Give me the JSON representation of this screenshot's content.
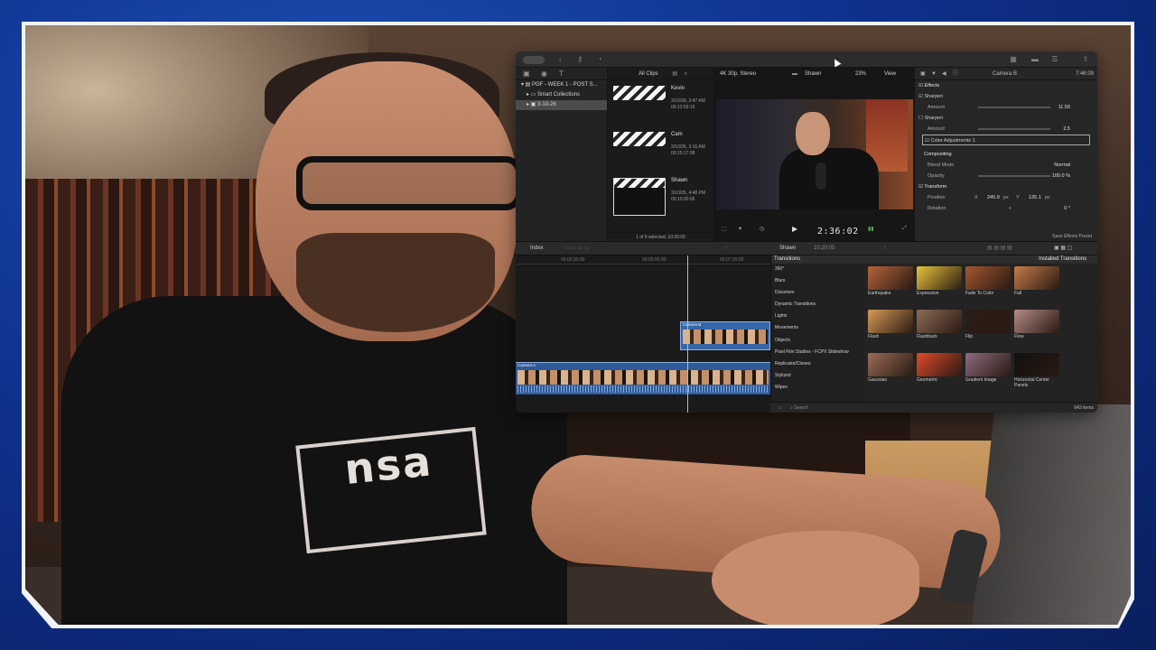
{
  "fcp": {
    "sidebar": {
      "items": [
        "PGF - WEEK 1 - POST S...",
        "Smart Collections",
        "3-10-26"
      ]
    },
    "browser": {
      "filter": "All Clips",
      "clips": [
        {
          "name": "Kevin",
          "meta1": "3/10/26, 2:47 AM",
          "meta2": "00:12:59:15"
        },
        {
          "name": "Cam",
          "meta1": "3/10/26, 3:16 AM",
          "meta2": "00:15:17:08"
        },
        {
          "name": "Shawn",
          "meta1": "3/10/26, 4:48 PM",
          "meta2": "00:10:20:05"
        }
      ],
      "status": "1 of 5 selected, 10:20:05"
    },
    "viewer": {
      "format": "4K 30p, Stereo",
      "clip": "Shawn",
      "zoom": "23%",
      "view": "View",
      "timecode": "2:36:02"
    },
    "inspector": {
      "title": "Camera B",
      "duration": "7:46:09",
      "effects": "Effects",
      "sharpen1": "Sharpen",
      "amount_label": "Amount",
      "amount1": "11.59",
      "sharpen2": "Sharpen",
      "amount2": "2.5",
      "color_adj": "Color Adjustments 1",
      "compositing": "Compositing",
      "blend_mode": "Blend Mode",
      "blend_value": "Normal",
      "opacity": "Opacity",
      "opacity_value": "100.0 %",
      "transform": "Transform",
      "position": "Position",
      "pos_x_label": "X",
      "pos_x": "245.9",
      "pos_y_label": "Y",
      "pos_y": "135.1",
      "unit": "px",
      "rotation": "Rotation",
      "rotation_value": "0 °",
      "save_preset": "Save Effects Preset"
    },
    "timeline": {
      "index": "Index",
      "clip": "Shawn",
      "duration": "10:20:05",
      "ruler": [
        "00:02:30:00",
        "00:05:00:00",
        "00:07:30:00"
      ],
      "clip_b": "Camera B",
      "clip_a": "Camera A"
    },
    "transitions": {
      "header": "Transitions",
      "installed": "Installed Transitions",
      "categories": [
        "360°",
        "Blurs",
        "Dissolves",
        "Dynamic Transitions",
        "Lights",
        "Movements",
        "Objects",
        "Pixel Film Studios - FCPX Slideshow",
        "Replicator/Clones",
        "Stylized",
        "Wipes"
      ],
      "items": [
        {
          "label": "Earthquake",
          "color": "#b7653a"
        },
        {
          "label": "Expressive",
          "color": "#e8c43a"
        },
        {
          "label": "Fade To Color",
          "color": "#a45631"
        },
        {
          "label": "Fall",
          "color": "#c57a48"
        },
        {
          "label": "Flash",
          "color": "#d79b55"
        },
        {
          "label": "Flashback",
          "color": "#8c6a55"
        },
        {
          "label": "Flip",
          "color": "#2a1c17"
        },
        {
          "label": "Flow",
          "color": "#b58a88"
        },
        {
          "label": "Gaussian",
          "color": "#9b6d56"
        },
        {
          "label": "Geometric",
          "color": "#e04a2a"
        },
        {
          "label": "Gradient Image",
          "color": "#8e6b80"
        },
        {
          "label": "Horizontal Center Panels",
          "color": "#101010"
        }
      ],
      "search_placeholder": "Search",
      "count": "643 items"
    }
  },
  "shirt_text": "nsa"
}
